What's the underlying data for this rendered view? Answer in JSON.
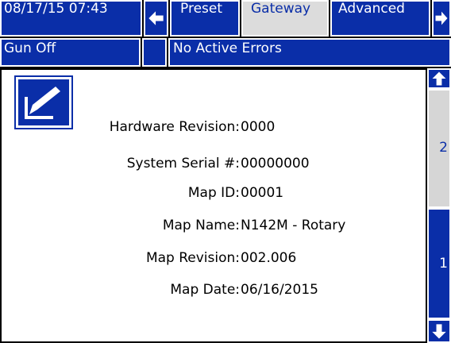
{
  "header": {
    "datetime": "08/17/15 07:43",
    "nav_left_icon": "arrow-left-icon",
    "tabs": [
      {
        "label": "Preset",
        "active": false
      },
      {
        "label": "Gateway",
        "active": true
      },
      {
        "label": "Advanced",
        "active": false
      }
    ],
    "nav_right_icon": "arrow-right-icon"
  },
  "status": {
    "gun": "Gun Off",
    "errors": "No Active Errors"
  },
  "main": {
    "edit_icon": "edit-icon",
    "fields": [
      {
        "label": "Hardware Revision:",
        "value": "0000"
      },
      {
        "label": "System Serial #:",
        "value": "00000000"
      },
      {
        "label": "Map ID:",
        "value": "00001"
      },
      {
        "label": "Map Name:",
        "value": "N142M - Rotary"
      },
      {
        "label": "Map Revision:",
        "value": "002.006"
      },
      {
        "label": "Map Date:",
        "value": "06/16/2015"
      }
    ]
  },
  "sidebar": {
    "up_icon": "arrow-up-icon",
    "pages": [
      "2",
      "1"
    ],
    "down_icon": "arrow-down-icon"
  },
  "colors": {
    "accent": "#0a2ea8",
    "active_tab_bg": "#dcdcdc",
    "content_bg": "#ffffff"
  }
}
